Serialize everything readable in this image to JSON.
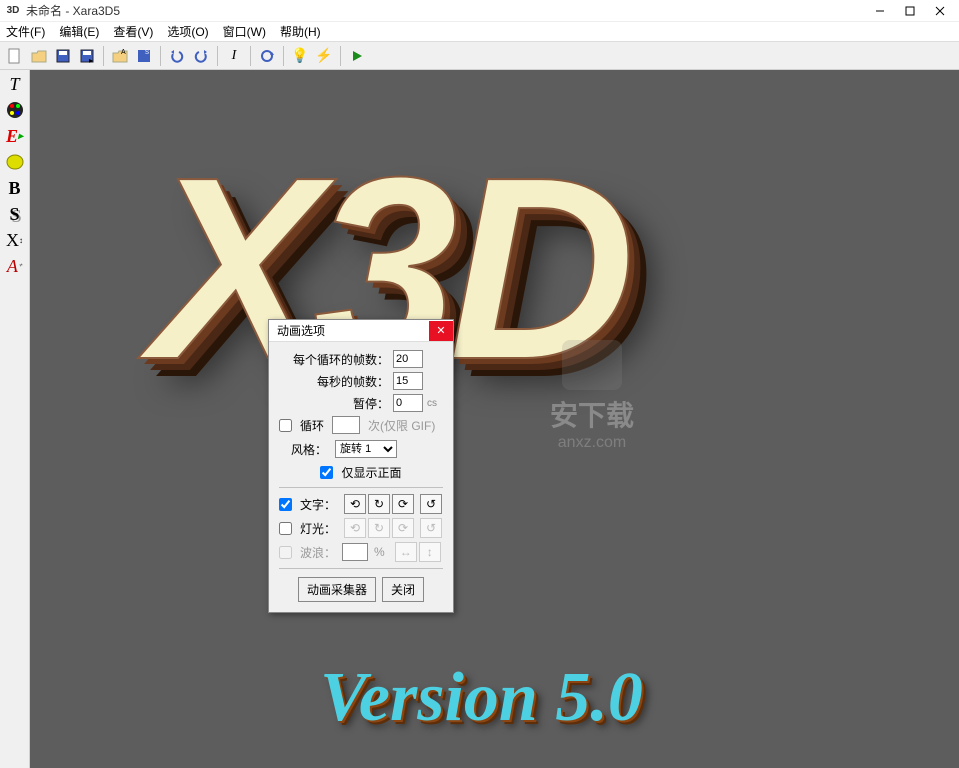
{
  "title": {
    "icon_text": "3D",
    "text": "未命名 - Xara3D5"
  },
  "menu": {
    "file": "文件(F)",
    "edit": "编辑(E)",
    "view": "查看(V)",
    "options": "选项(O)",
    "window": "窗口(W)",
    "help": "帮助(H)"
  },
  "toolbar_icons": [
    "new",
    "open",
    "save",
    "save-as",
    "open-folder",
    "save-settings",
    "undo",
    "redo",
    "text-cursor",
    "reload",
    "bulb",
    "bolt",
    "play"
  ],
  "sidebar": [
    {
      "name": "text-tool",
      "glyph": "T",
      "style": "font-style:italic;color:#000;"
    },
    {
      "name": "color-tool",
      "glyph": "❀",
      "style": "color:#e60000;"
    },
    {
      "name": "extrude-tool",
      "glyph": "E",
      "style": "color:#d00;font-style:italic;"
    },
    {
      "name": "bevel-tool",
      "glyph": "◯",
      "style": "background:#dd0;border-radius:50%;width:16px;height:16px;"
    },
    {
      "name": "bold-tool",
      "glyph": "B",
      "style": "font-weight:bold;"
    },
    {
      "name": "shadow-tool",
      "glyph": "S",
      "style": "font-weight:bold;text-shadow:1px 1px #888;"
    },
    {
      "name": "x-tool",
      "glyph": "X",
      "style": ""
    },
    {
      "name": "font-tool",
      "glyph": "A",
      "style": "font-style:italic;color:#b00;"
    }
  ],
  "canvas": {
    "main_text": "X3D",
    "version_text": "Version 5.0"
  },
  "watermark": {
    "name": "安下载",
    "url": "anxz.com"
  },
  "dialog": {
    "title": "动画选项",
    "frames_per_loop_label": "每个循环的帧数：",
    "frames_per_loop": "20",
    "fps_label": "每秒的帧数：",
    "fps": "15",
    "pause_label": "暂停：",
    "pause": "0",
    "pause_unit": "cs",
    "loop_label": "循环",
    "loop_times_label": "次(仅限 GIF)",
    "style_label": "风格：",
    "style_value": "旋转 1",
    "style_options": [
      "旋转 1"
    ],
    "front_only_label": "仅显示正面",
    "text_row_label": "文字：",
    "light_row_label": "灯光：",
    "wave_row_label": "波浪：",
    "wave_unit": "%",
    "collector_btn": "动画采集器",
    "close_btn": "关闭"
  }
}
